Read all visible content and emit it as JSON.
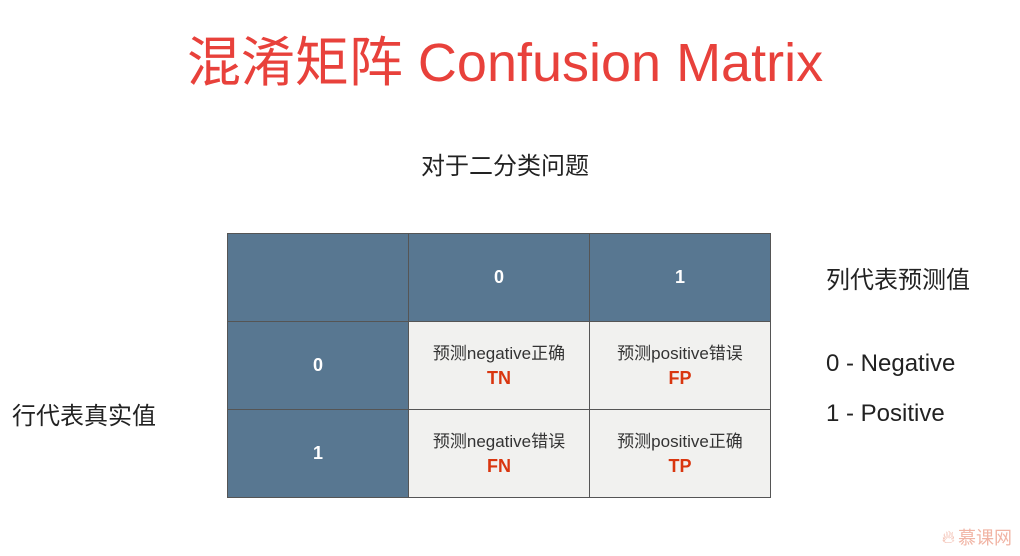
{
  "title": "混淆矩阵 Confusion Matrix",
  "subtitle": "对于二分类问题",
  "matrix": {
    "col_headers": [
      "0",
      "1"
    ],
    "rows": [
      {
        "header": "0",
        "cells": [
          {
            "text": "预测negative正确",
            "abbr": "TN"
          },
          {
            "text": "预测positive错误",
            "abbr": "FP"
          }
        ]
      },
      {
        "header": "1",
        "cells": [
          {
            "text": "预测negative错误",
            "abbr": "FN"
          },
          {
            "text": "预测positive正确",
            "abbr": "TP"
          }
        ]
      }
    ]
  },
  "col_note": "列代表预测值",
  "row_note": "行代表真实值",
  "legend": [
    "0 - Negative",
    "1 - Positive"
  ],
  "watermark": "慕课网",
  "colors": {
    "title": "#e8413b",
    "header": "#587791",
    "abbr": "#d9360f"
  }
}
